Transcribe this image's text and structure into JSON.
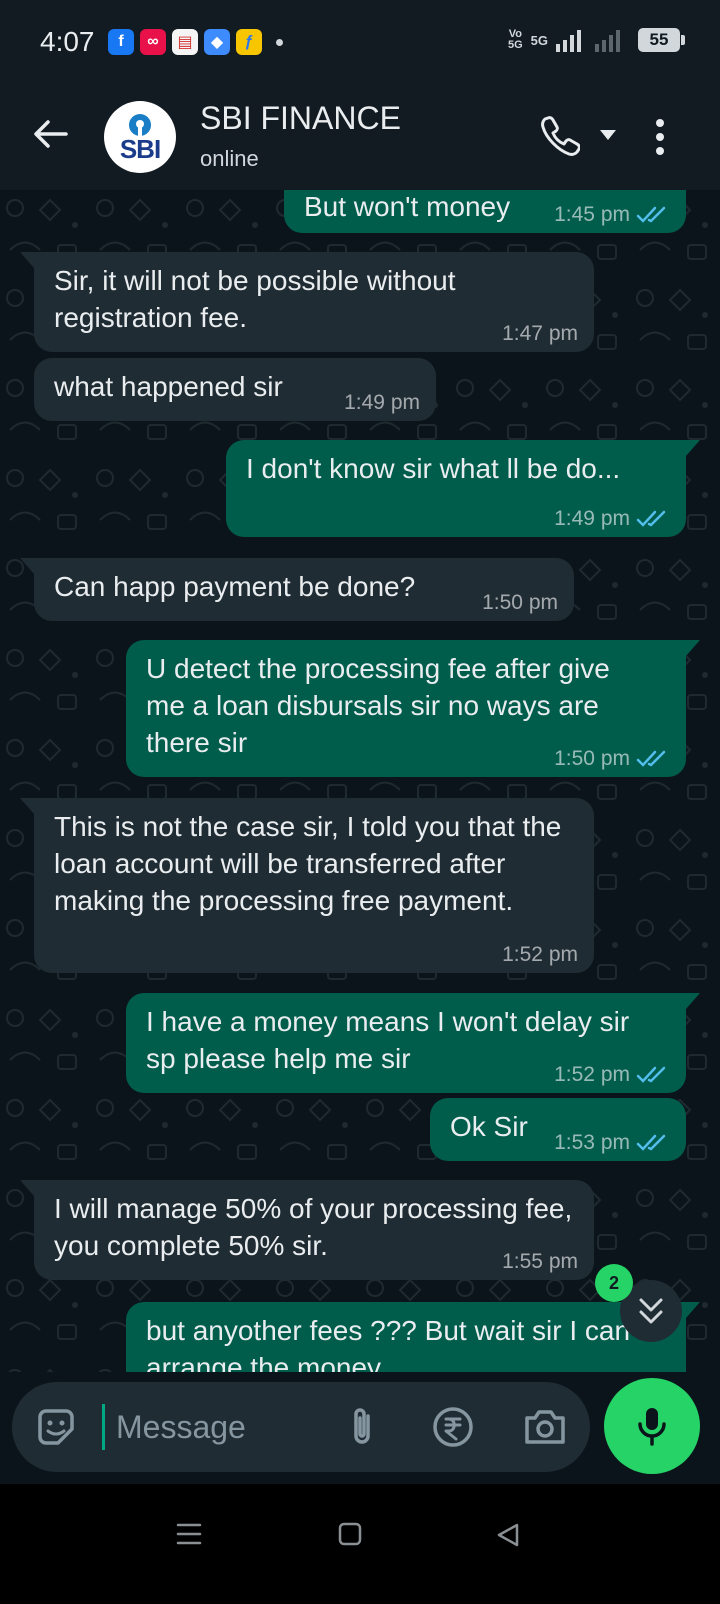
{
  "status_bar": {
    "time": "4:07",
    "notifications": [
      {
        "icon": "facebook-icon",
        "color": "#1877f2",
        "glyph": "f"
      },
      {
        "icon": "app-icon",
        "color": "#e8114a",
        "glyph": "∞"
      },
      {
        "icon": "news-app-icon",
        "color": "#d32f2f",
        "glyph": "▤"
      },
      {
        "icon": "browser-icon",
        "color": "#3d8bfd",
        "glyph": "◆"
      },
      {
        "icon": "flipkart-icon",
        "color": "#2874f0",
        "glyph": "ƒ"
      }
    ],
    "volte_top": "Vo",
    "volte_bottom": "5G",
    "network": "5G",
    "battery": "55"
  },
  "header": {
    "contact_name": "SBI FINANCE",
    "status": "online",
    "avatar_text": "SBI"
  },
  "messages": [
    {
      "dir": "out",
      "text": "But won't money",
      "time": "1:45 pm",
      "read": true
    },
    {
      "dir": "in",
      "text": "Sir, it will not be possible without registration fee.",
      "time": "1:47 pm"
    },
    {
      "dir": "in",
      "text": "what happened sir",
      "time": "1:49 pm"
    },
    {
      "dir": "out",
      "text": "I don't know sir what ll be do...",
      "time": "1:49 pm",
      "read": true
    },
    {
      "dir": "in",
      "text": "Can happ payment be done?",
      "time": "1:50 pm"
    },
    {
      "dir": "out",
      "text": "U detect the processing fee after give me a loan disbursals sir no ways are there sir",
      "time": "1:50 pm",
      "read": true
    },
    {
      "dir": "in",
      "text": "This is not the case sir, I told you that the loan account will be transferred after making the processing free payment.",
      "time": "1:52 pm"
    },
    {
      "dir": "out",
      "text": "I have a money means I won't delay sir sp please help me sir",
      "time": "1:52 pm",
      "read": true
    },
    {
      "dir": "out",
      "text": "Ok Sir",
      "time": "1:53 pm",
      "read": true
    },
    {
      "dir": "in",
      "text": "I will manage 50% of your processing fee, you complete 50% sir.",
      "time": "1:55 pm"
    },
    {
      "dir": "out",
      "text": "but anyother fees ??? But wait sir I can arrange the money",
      "time": "",
      "read": true
    }
  ],
  "scroll_button": {
    "unread_count": "2"
  },
  "composer": {
    "placeholder": "Message"
  },
  "colors": {
    "incoming_bubble": "#202c33",
    "outgoing_bubble": "#005c4b",
    "accent": "#25d366",
    "read_tick": "#53bdeb",
    "background": "#0b141a"
  }
}
